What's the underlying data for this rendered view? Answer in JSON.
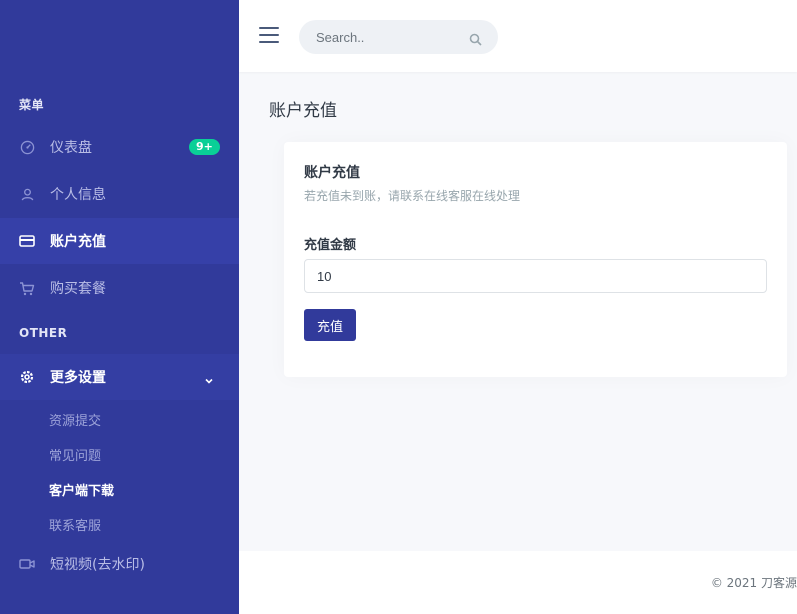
{
  "sidebar": {
    "menu_label": "菜单",
    "other_label": "OTHER",
    "items": [
      {
        "label": "仪表盘",
        "icon": "dashboard-icon",
        "badge": "9+"
      },
      {
        "label": "个人信息",
        "icon": "user-icon"
      },
      {
        "label": "账户充值",
        "icon": "credit-card-icon",
        "active": true
      },
      {
        "label": "购买套餐",
        "icon": "cart-icon"
      }
    ],
    "more_settings": {
      "label": "更多设置",
      "icon": "gear-icon",
      "expanded": true,
      "children": [
        {
          "label": "资源提交"
        },
        {
          "label": "常见问题"
        },
        {
          "label": "客户端下载",
          "current": true
        },
        {
          "label": "联系客服"
        }
      ]
    },
    "video_item": {
      "label": "短视频(去水印)",
      "icon": "video-icon"
    }
  },
  "topbar": {
    "search_placeholder": "Search.."
  },
  "page": {
    "title": "账户充值"
  },
  "card": {
    "title": "账户充值",
    "subtitle": "若充值未到账，请联系在线客服在线处理",
    "amount_label": "充值金额",
    "amount_value": "10",
    "submit_label": "充值"
  },
  "footer": {
    "copyright": "© 2021 刀客源"
  },
  "colors": {
    "sidebar_bg": "#313a9b",
    "accent": "#313a9b",
    "badge": "#0acf97"
  }
}
